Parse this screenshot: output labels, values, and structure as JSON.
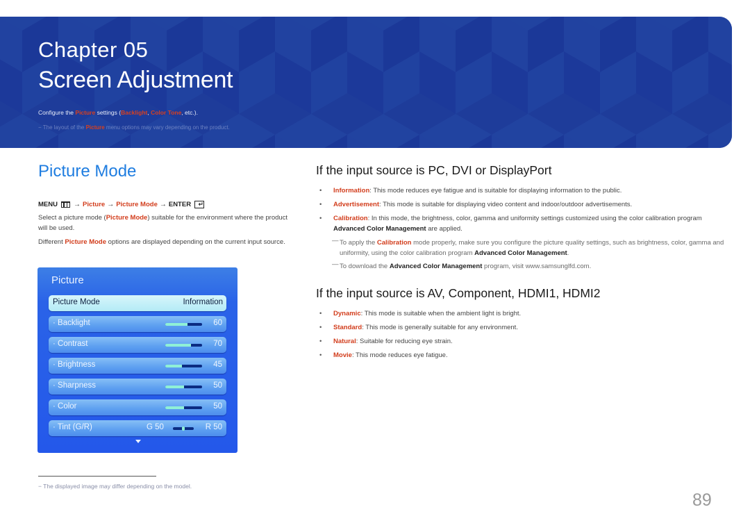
{
  "banner": {
    "chapter_label": "Chapter  05",
    "title": "Screen Adjustment",
    "desc": {
      "prefix": "Configure the ",
      "picture": "Picture",
      "mid": " settings (",
      "backlight": "Backlight",
      "comma": ", ",
      "color_tone": "Color Tone",
      "suffix": ", etc.)."
    },
    "note": {
      "dash": "−",
      "prefix": " The layout of the ",
      "picture": "Picture",
      "suffix": " menu options may vary depending on the product."
    },
    "colors": {
      "background": "#1e3c9a",
      "highlight": "#d23d1c"
    }
  },
  "picture_mode": {
    "title": "Picture Mode",
    "menu_path": {
      "menu": "MENU",
      "menu_icon": "menu-icon",
      "arrow": "→",
      "step1": "Picture",
      "step2": "Picture Mode",
      "enter": "ENTER",
      "enter_icon": "enter-icon"
    },
    "para1": {
      "prefix": "Select a picture mode (",
      "hl": "Picture Mode",
      "suffix": ") suitable for the environment where the product will be used."
    },
    "para2": {
      "prefix": "Different ",
      "hl": "Picture Mode",
      "suffix": " options are displayed depending on the current input source."
    }
  },
  "osd_panel": {
    "title": "Picture",
    "rows": [
      {
        "label": "Picture Mode",
        "value": "Information",
        "selected": true
      },
      {
        "label": "· Backlight",
        "value": "60",
        "level": 0.6
      },
      {
        "label": "· Contrast",
        "value": "70",
        "level": 0.7
      },
      {
        "label": "· Brightness",
        "value": "45",
        "level": 0.45
      },
      {
        "label": "· Sharpness",
        "value": "50",
        "level": 0.5
      },
      {
        "label": "· Color",
        "value": "50",
        "level": 0.5
      }
    ],
    "tint": {
      "label": "· Tint (G/R)",
      "green": "G 50",
      "red": "R 50",
      "balance": 0.5
    },
    "more_icon": "down-arrow-icon"
  },
  "pc_section": {
    "heading": "If the input source is PC, DVI or DisplayPort",
    "items": [
      {
        "term": "Information",
        "text": ": This mode reduces eye fatigue and is suitable for displaying information to the public."
      },
      {
        "term": "Advertisement",
        "text": ": This mode is suitable for displaying video content and indoor/outdoor advertisements."
      },
      {
        "term": "Calibration",
        "text": ": In this mode, the brightness, color, gamma and uniformity settings customized using the color calibration program ",
        "bold": "Advanced Color Management",
        "tail": " are applied."
      }
    ],
    "notes": [
      {
        "dash": "—",
        "prefix": "To apply the ",
        "hl": "Calibration",
        "mid": " mode properly, make sure you configure the picture quality settings, such as brightness, color, gamma and uniformity, using the color calibration program ",
        "bold": "Advanced Color Management",
        "suffix": "."
      },
      {
        "dash": "—",
        "prefix": "To download the ",
        "bold": "Advanced Color Management",
        "suffix": " program, visit www.samsunglfd.com."
      }
    ]
  },
  "av_section": {
    "heading": "If the input source is AV, Component, HDMI1, HDMI2",
    "items": [
      {
        "term": "Dynamic",
        "text": ": This mode is suitable when the ambient light is bright."
      },
      {
        "term": "Standard",
        "text": ": This mode is generally suitable for any environment."
      },
      {
        "term": "Natural",
        "text": ": Suitable for reducing eye strain."
      },
      {
        "term": "Movie",
        "text": ": This mode reduces eye fatigue."
      }
    ]
  },
  "footnote": {
    "dash": "−",
    "text": " The displayed image may differ depending on the model."
  },
  "page_number": "89"
}
